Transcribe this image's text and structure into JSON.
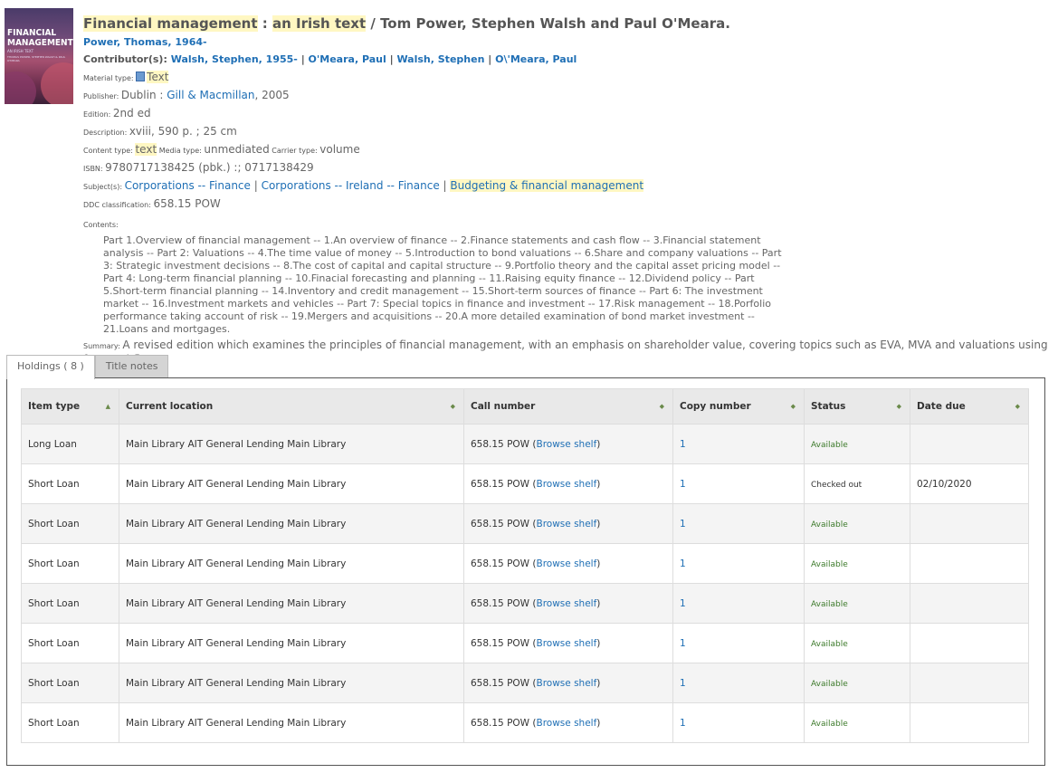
{
  "record": {
    "title_main": "Financial management",
    "title_sep": " : ",
    "title_sub": "an Irish text",
    "title_resp": " / Tom Power, Stephen Walsh and Paul O'Meara.",
    "author": "Power, Thomas, 1964-",
    "contributors_label": "Contributor(s): ",
    "contributors": [
      "Walsh, Stephen, 1955-",
      "O'Meara, Paul",
      "Walsh, Stephen",
      "O\\'Meara, Paul"
    ],
    "material_label": "Material type: ",
    "material": "Text",
    "publisher_label": "Publisher: ",
    "publisher_place": "Dublin : ",
    "publisher_name": "Gill & Macmillan",
    "publisher_year": ", 2005",
    "edition_label": "Edition: ",
    "edition": "2nd ed",
    "description_label": "Description: ",
    "description": "xviii, 590 p. ; 25 cm",
    "content_type_label": "Content type: ",
    "content_type": "text",
    "media_type_label": " Media type: ",
    "media_type": "unmediated",
    "carrier_type_label": " Carrier type: ",
    "carrier_type": "volume",
    "isbn_label": "ISBN: ",
    "isbn": "9780717138425 (pbk.) :; 0717138429",
    "subjects_label": "Subject(s): ",
    "subjects": [
      "Corporations -- Finance",
      "Corporations -- Ireland -- Finance",
      "Budgeting & financial management"
    ],
    "ddc_label": "DDC classification: ",
    "ddc": "658.15 POW",
    "contents_label": "Contents:",
    "contents": "Part 1.Overview of financial management -- 1.An overview of finance -- 2.Finance statements and cash flow -- 3.Financial statement analysis -- Part 2: Valuations -- 4.The time value of money -- 5.Introduction to bond valuations -- 6.Share and company valuations -- Part 3: Strategic investment decisions -- 8.The cost of capital and capital structure -- 9.Portfolio theory and the capital asset pricing model -- Part 4: Long-term financial planning -- 10.Finacial forecasting and planning -- 11.Raising equity finance -- 12.Dividend policy -- Part 5.Short-term financial planning -- 14.Inventory and credit management -- 15.Short-term sources of finance -- Part 6: The investment market -- 16.Investment markets and vehicles -- Part 7: Special topics in finance and investment -- 17.Risk management -- 18.Porfolio performance taking account of risk -- 19.Mergers and acquisitions -- 20.A more detailed examination of bond market investment -- 21.Loans and mortgages.",
    "summary_label": "Summary: ",
    "summary": "A revised edition which examines the principles of financial management, with an emphasis on shareholder value, covering topics such as EVA, MVA and valuations using free cashflow."
  },
  "cover": {
    "line1": "FINANCIAL",
    "line2": "MANAGEMENT",
    "line3": "AN IRISH TEXT",
    "line4": "THOMAS POWER, STEPHEN WALSH & PAUL O'MEARA"
  },
  "tabs": [
    {
      "label": "Holdings ( 8 )",
      "active": true
    },
    {
      "label": "Title notes",
      "active": false
    }
  ],
  "holdings": {
    "columns": [
      "Item type",
      "Current location",
      "Call number",
      "Copy number",
      "Status",
      "Date due"
    ],
    "rows": [
      {
        "item_type": "Long Loan",
        "location": "Main Library AIT General Lending Main Library",
        "call": "658.15 POW",
        "browse": "Browse shelf",
        "copy": "1",
        "status": "Available",
        "due": ""
      },
      {
        "item_type": "Short Loan",
        "location": "Main Library AIT General Lending Main Library",
        "call": "658.15 POW",
        "browse": "Browse shelf",
        "copy": "1",
        "status": "Checked out",
        "due": "02/10/2020"
      },
      {
        "item_type": "Short Loan",
        "location": "Main Library AIT General Lending Main Library",
        "call": "658.15 POW",
        "browse": "Browse shelf",
        "copy": "1",
        "status": "Available",
        "due": ""
      },
      {
        "item_type": "Short Loan",
        "location": "Main Library AIT General Lending Main Library",
        "call": "658.15 POW",
        "browse": "Browse shelf",
        "copy": "1",
        "status": "Available",
        "due": ""
      },
      {
        "item_type": "Short Loan",
        "location": "Main Library AIT General Lending Main Library",
        "call": "658.15 POW",
        "browse": "Browse shelf",
        "copy": "1",
        "status": "Available",
        "due": ""
      },
      {
        "item_type": "Short Loan",
        "location": "Main Library AIT General Lending Main Library",
        "call": "658.15 POW",
        "browse": "Browse shelf",
        "copy": "1",
        "status": "Available",
        "due": ""
      },
      {
        "item_type": "Short Loan",
        "location": "Main Library AIT General Lending Main Library",
        "call": "658.15 POW",
        "browse": "Browse shelf",
        "copy": "1",
        "status": "Available",
        "due": ""
      },
      {
        "item_type": "Short Loan",
        "location": "Main Library AIT General Lending Main Library",
        "call": "658.15 POW",
        "browse": "Browse shelf",
        "copy": "1",
        "status": "Available",
        "due": ""
      }
    ]
  },
  "colors": {
    "link": "#1f6fb5",
    "highlight": "#fff7c2",
    "available": "#3c7a2a"
  }
}
